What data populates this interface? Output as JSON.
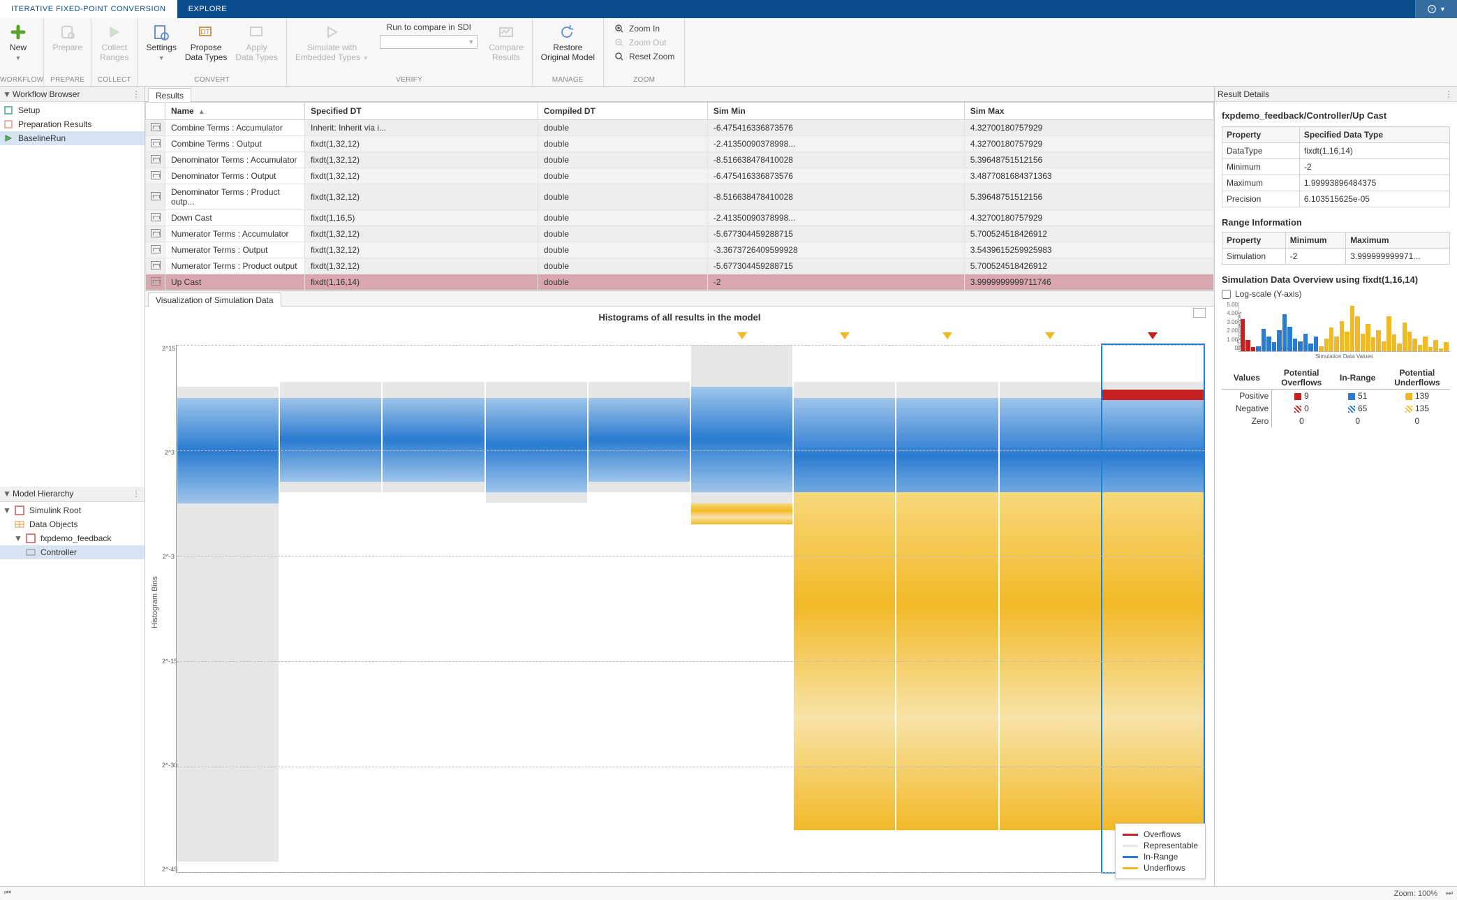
{
  "tabs": {
    "active": "ITERATIVE FIXED-POINT CONVERSION",
    "other": "EXPLORE"
  },
  "ribbon": {
    "groups": {
      "workflow": {
        "label": "WORKFLOW",
        "new": "New"
      },
      "prepare": {
        "label": "PREPARE",
        "prepare": "Prepare"
      },
      "collect": {
        "label": "COLLECT",
        "collect": "Collect\nRanges"
      },
      "convert": {
        "label": "CONVERT",
        "settings": "Settings",
        "propose": "Propose\nData Types",
        "apply": "Apply\nData Types"
      },
      "verify": {
        "label": "VERIFY",
        "simwith": "Simulate with\nEmbedded Types",
        "runcompare": "Run to compare in SDI",
        "compare": "Compare\nResults"
      },
      "manage": {
        "label": "MANAGE",
        "restore": "Restore\nOriginal Model"
      },
      "zoom": {
        "label": "ZOOM",
        "in": "Zoom In",
        "out": "Zoom Out",
        "reset": "Reset Zoom"
      }
    }
  },
  "workflowBrowser": {
    "title": "Workflow Browser",
    "items": [
      {
        "label": "Setup",
        "key": "setup"
      },
      {
        "label": "Preparation Results",
        "key": "prep-results"
      },
      {
        "label": "BaselineRun",
        "key": "baseline-run",
        "selected": true
      }
    ]
  },
  "modelHierarchy": {
    "title": "Model Hierarchy",
    "root": "Simulink Root",
    "dataobjects": "Data Objects",
    "model": "fxpdemo_feedback",
    "controller": "Controller"
  },
  "resultsTab": "Results",
  "resultsTable": {
    "headers": {
      "name": "Name",
      "specified": "Specified DT",
      "compiled": "Compiled DT",
      "simmin": "Sim Min",
      "simmax": "Sim Max"
    },
    "rows": [
      {
        "name": "Combine Terms : Accumulator",
        "spec": "Inherit: Inherit via i...",
        "comp": "double",
        "min": "-6.475416336873576",
        "max": "4.32700180757929"
      },
      {
        "name": "Combine Terms : Output",
        "spec": "fixdt(1,32,12)",
        "comp": "double",
        "min": "-2.41350090378998...",
        "max": "4.32700180757929"
      },
      {
        "name": "Denominator Terms : Accumulator",
        "spec": "fixdt(1,32,12)",
        "comp": "double",
        "min": "-8.516638478410028",
        "max": "5.39648751512156"
      },
      {
        "name": "Denominator Terms : Output",
        "spec": "fixdt(1,32,12)",
        "comp": "double",
        "min": "-6.475416336873576",
        "max": "3.4877081684371363"
      },
      {
        "name": "Denominator Terms : Product outp...",
        "spec": "fixdt(1,32,12)",
        "comp": "double",
        "min": "-8.516638478410028",
        "max": "5.39648751512156"
      },
      {
        "name": "Down Cast",
        "spec": "fixdt(1,16,5)",
        "comp": "double",
        "min": "-2.41350090378998...",
        "max": "4.32700180757929"
      },
      {
        "name": "Numerator Terms : Accumulator",
        "spec": "fixdt(1,32,12)",
        "comp": "double",
        "min": "-5.677304459288715",
        "max": "5.700524518426912"
      },
      {
        "name": "Numerator Terms : Output",
        "spec": "fixdt(1,32,12)",
        "comp": "double",
        "min": "-3.3673726409599928",
        "max": "3.5439615259925983"
      },
      {
        "name": "Numerator Terms : Product output",
        "spec": "fixdt(1,32,12)",
        "comp": "double",
        "min": "-5.677304459288715",
        "max": "5.700524518426912"
      },
      {
        "name": "Up Cast",
        "spec": "fixdt(1,16,14)",
        "comp": "double",
        "min": "-2",
        "max": "3.9999999999711746",
        "selected": true
      }
    ]
  },
  "vizTab": "Visualization of Simulation Data",
  "histogram": {
    "title": "Histograms of all results in the model",
    "ylabel": "Histogram Bins",
    "yticks": [
      "2^15",
      "2^3",
      "2^-3",
      "2^-15",
      "2^-30",
      "2^-45"
    ],
    "legend": {
      "overflows": "Overflows",
      "rep": "Representable",
      "in": "In-Range",
      "under": "Underflows"
    },
    "colors": {
      "overflows": "#c62020",
      "rep": "#e6e6e6",
      "in": "#2a7bd1",
      "under": "#f2b927"
    }
  },
  "chart_data": {
    "type": "bar",
    "title": "Histograms of all results in the model",
    "ylabel": "Histogram Bins",
    "yticks_log2": [
      15,
      3,
      -3,
      -15,
      -30,
      -45
    ],
    "columns": [
      {
        "name": "Combine Terms : Accumulator",
        "rep": [
          0.08,
          0.98
        ],
        "in": [
          0.1,
          0.3
        ],
        "under": null,
        "marker": null
      },
      {
        "name": "Combine Terms : Output",
        "rep": [
          0.07,
          0.28
        ],
        "in": [
          0.1,
          0.26
        ],
        "under": null,
        "marker": null
      },
      {
        "name": "Denominator Terms : Accumulator",
        "rep": [
          0.07,
          0.28
        ],
        "in": [
          0.1,
          0.26
        ],
        "under": null,
        "marker": null
      },
      {
        "name": "Denominator Terms : Output",
        "rep": [
          0.07,
          0.3
        ],
        "in": [
          0.1,
          0.28
        ],
        "under": null,
        "marker": null
      },
      {
        "name": "Denominator Terms : Product",
        "rep": [
          0.07,
          0.28
        ],
        "in": [
          0.1,
          0.26
        ],
        "under": null,
        "marker": null
      },
      {
        "name": "Down Cast",
        "rep": [
          0.0,
          0.3
        ],
        "in": [
          0.08,
          0.28
        ],
        "under": [
          0.3,
          0.34
        ],
        "marker": "y"
      },
      {
        "name": "Numerator Terms : Accumulator",
        "rep": [
          0.07,
          0.28
        ],
        "in": [
          0.1,
          0.32
        ],
        "under": [
          0.28,
          0.92
        ],
        "marker": "y"
      },
      {
        "name": "Numerator Terms : Output",
        "rep": [
          0.07,
          0.28
        ],
        "in": [
          0.1,
          0.32
        ],
        "under": [
          0.28,
          0.92
        ],
        "marker": "y"
      },
      {
        "name": "Numerator Terms : Product",
        "rep": [
          0.07,
          0.28
        ],
        "in": [
          0.1,
          0.32
        ],
        "under": [
          0.28,
          0.92
        ],
        "marker": "y"
      },
      {
        "name": "Up Cast",
        "rep": [
          0.07,
          0.28
        ],
        "in": [
          0.1,
          0.32
        ],
        "under": [
          0.28,
          0.92
        ],
        "marker": "r",
        "overflow": [
          0.085,
          0.105
        ],
        "selected": true
      }
    ]
  },
  "resultDetails": {
    "title": "Result Details",
    "path": "fxpdemo_feedback/Controller/Up Cast",
    "specTable": {
      "headProp": "Property",
      "headVal": "Specified Data Type",
      "rows": [
        {
          "p": "DataType",
          "v": "fixdt(1,16,14)"
        },
        {
          "p": "Minimum",
          "v": "-2"
        },
        {
          "p": "Maximum",
          "v": "1.99993896484375"
        },
        {
          "p": "Precision",
          "v": "6.103515625e-05"
        }
      ]
    },
    "rangeTitle": "Range Information",
    "rangeTable": {
      "headProp": "Property",
      "headMin": "Minimum",
      "headMax": "Maximum",
      "rows": [
        {
          "p": "Simulation",
          "min": "-2",
          "max": "3.999999999971..."
        }
      ]
    },
    "overviewTitle": "Simulation Data Overview using fixdt(1,16,14)",
    "logscale": "Log-scale (Y-axis)",
    "miniChart": {
      "ylabel": "% Occurrences",
      "xlabel": "Simulation Data Values",
      "yticks": [
        "5.00",
        "4.00",
        "3.00",
        "2.00",
        "1.00",
        "0"
      ],
      "bars": [
        {
          "h": 0.65,
          "c": "#c62020"
        },
        {
          "h": 0.22,
          "c": "#c62020"
        },
        {
          "h": 0.08,
          "c": "#c62020"
        },
        {
          "h": 0.1,
          "c": "#2a7bd1"
        },
        {
          "h": 0.45,
          "c": "#2a7bd1"
        },
        {
          "h": 0.3,
          "c": "#2a7bd1"
        },
        {
          "h": 0.18,
          "c": "#2a7bd1"
        },
        {
          "h": 0.42,
          "c": "#2a7bd1"
        },
        {
          "h": 0.74,
          "c": "#2a7bd1"
        },
        {
          "h": 0.5,
          "c": "#2a7bd1"
        },
        {
          "h": 0.25,
          "c": "#2a7bd1"
        },
        {
          "h": 0.2,
          "c": "#2a7bd1"
        },
        {
          "h": 0.35,
          "c": "#2a7bd1"
        },
        {
          "h": 0.15,
          "c": "#2a7bd1"
        },
        {
          "h": 0.3,
          "c": "#2a7bd1"
        },
        {
          "h": 0.1,
          "c": "#f2b927"
        },
        {
          "h": 0.25,
          "c": "#f2b927"
        },
        {
          "h": 0.48,
          "c": "#f2b927"
        },
        {
          "h": 0.3,
          "c": "#f2b927"
        },
        {
          "h": 0.6,
          "c": "#f2b927"
        },
        {
          "h": 0.4,
          "c": "#f2b927"
        },
        {
          "h": 0.92,
          "c": "#f2b927"
        },
        {
          "h": 0.7,
          "c": "#f2b927"
        },
        {
          "h": 0.35,
          "c": "#f2b927"
        },
        {
          "h": 0.55,
          "c": "#f2b927"
        },
        {
          "h": 0.28,
          "c": "#f2b927"
        },
        {
          "h": 0.42,
          "c": "#f2b927"
        },
        {
          "h": 0.2,
          "c": "#f2b927"
        },
        {
          "h": 0.7,
          "c": "#f2b927"
        },
        {
          "h": 0.34,
          "c": "#f2b927"
        },
        {
          "h": 0.15,
          "c": "#f2b927"
        },
        {
          "h": 0.58,
          "c": "#f2b927"
        },
        {
          "h": 0.4,
          "c": "#f2b927"
        },
        {
          "h": 0.25,
          "c": "#f2b927"
        },
        {
          "h": 0.12,
          "c": "#f2b927"
        },
        {
          "h": 0.3,
          "c": "#f2b927"
        },
        {
          "h": 0.08,
          "c": "#f2b927"
        },
        {
          "h": 0.22,
          "c": "#f2b927"
        },
        {
          "h": 0.06,
          "c": "#f2b927"
        },
        {
          "h": 0.18,
          "c": "#f2b927"
        }
      ]
    },
    "summary": {
      "colValues": "Values",
      "colOverflows": "Potential\nOverflows",
      "colIn": "In-Range",
      "colUnder": "Potential\nUnderflows",
      "rows": [
        {
          "lbl": "Positive",
          "ov": "9",
          "in": "51",
          "un": "139",
          "ovc": "#c62020",
          "inc": "#2a7bd1",
          "unc": "#f2b927",
          "solid": true
        },
        {
          "lbl": "Negative",
          "ov": "0",
          "in": "65",
          "un": "135",
          "ovc": "#c62020",
          "inc": "#2a7bd1",
          "unc": "#f2b927",
          "solid": false
        },
        {
          "lbl": "Zero",
          "ov": "0",
          "in": "0",
          "un": "0",
          "ovc": null,
          "inc": null,
          "unc": null,
          "solid": true
        }
      ]
    }
  },
  "statusbar": {
    "zoom": "Zoom: 100%"
  }
}
